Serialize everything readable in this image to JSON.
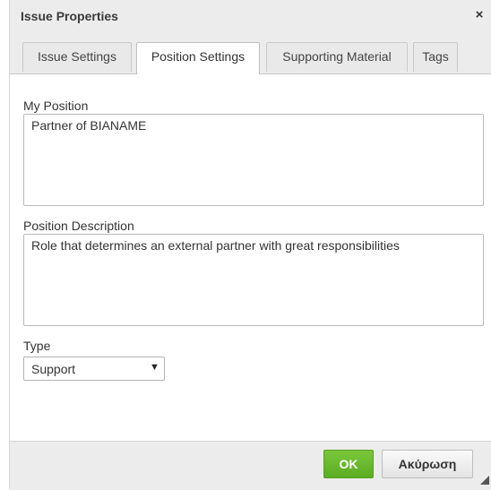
{
  "dialog": {
    "title": "Issue Properties",
    "close_glyph": "×"
  },
  "tabs": [
    {
      "label": "Issue Settings",
      "active": false
    },
    {
      "label": "Position Settings",
      "active": true
    },
    {
      "label": "Supporting Material",
      "active": false
    },
    {
      "label": "Tags",
      "active": false
    }
  ],
  "form": {
    "my_position": {
      "label": "My Position",
      "value": "Partner of BIANAME"
    },
    "position_description": {
      "label": "Position Description",
      "value": "Role that determines an external partner with great responsibilities"
    },
    "type": {
      "label": "Type",
      "selected": "Support",
      "arrow_glyph": "▼"
    }
  },
  "footer": {
    "ok_label": "OK",
    "cancel_label": "Ακύρωση"
  },
  "colors": {
    "ok_button": "#5aad23",
    "titlebar": "#ececec"
  },
  "icons": {
    "close": "close-icon",
    "select_arrow": "chevron-down-icon",
    "resize": "resize-grip-icon"
  }
}
